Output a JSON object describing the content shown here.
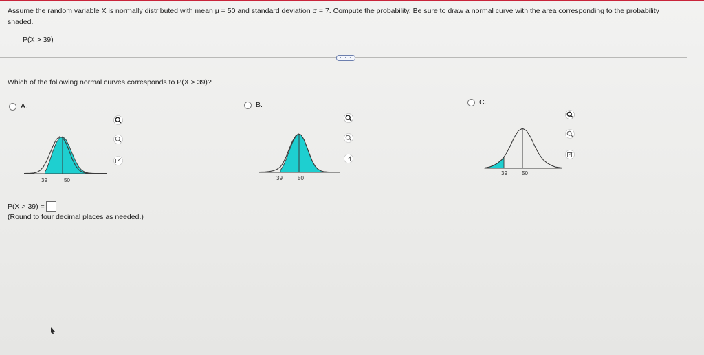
{
  "prompt": {
    "text": "Assume the random variable X is normally distributed with mean μ = 50 and standard deviation σ = 7. Compute the probability. Be sure to draw a normal curve with the area corresponding to the probability shaded.",
    "probability": "P(X > 39)"
  },
  "more_button": "· · ·",
  "question": "Which of the following normal curves corresponds to P(X > 39)?",
  "options": [
    {
      "letter": "A.",
      "ticks": [
        "39",
        "50"
      ],
      "shaded": "right of 39"
    },
    {
      "letter": "B.",
      "ticks": [
        "39",
        "50"
      ],
      "shaded": "right of 39 to tail"
    },
    {
      "letter": "C.",
      "ticks": [
        "39",
        "50"
      ],
      "shaded": "left of 39"
    }
  ],
  "tools": [
    "zoom-in-icon",
    "zoom-out-icon",
    "open-external-icon"
  ],
  "answer": {
    "label": "P(X > 39) =",
    "value": ""
  },
  "round_note": "(Round to four decimal places as needed.)",
  "colors": {
    "shade": "#1ecfd0",
    "accent_line": "#c9243a"
  }
}
